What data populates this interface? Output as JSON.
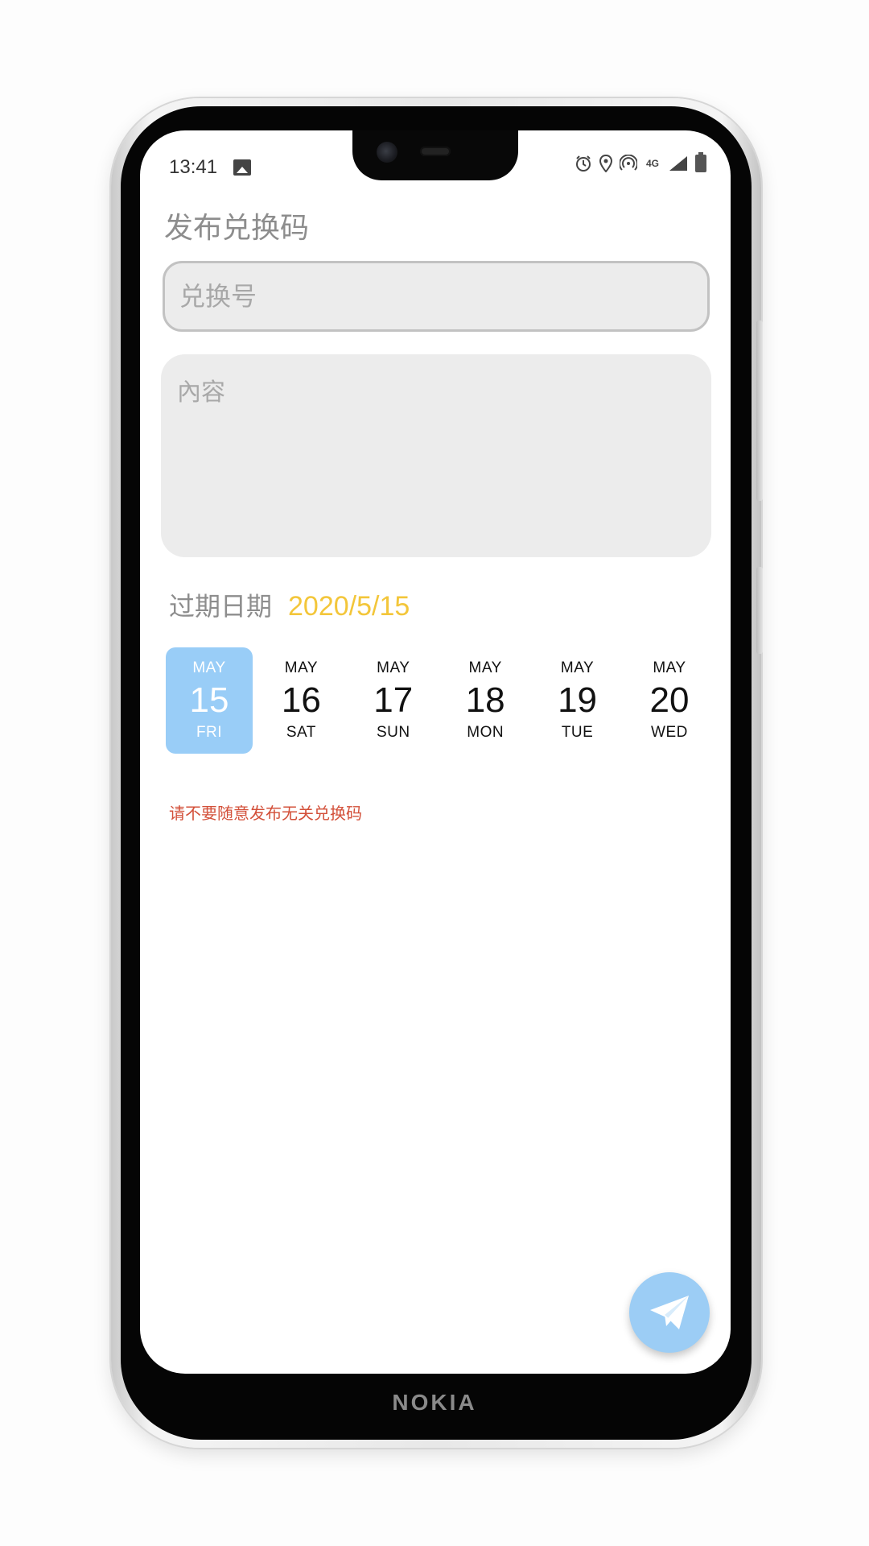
{
  "device": {
    "brand": "NOKIA"
  },
  "status_bar": {
    "time": "13:41",
    "network_label": "4G",
    "signal_label": "4G"
  },
  "page": {
    "title": "发布兑换码"
  },
  "form": {
    "code_placeholder": "兑换号",
    "code_value": "",
    "content_placeholder": "內容",
    "content_value": ""
  },
  "expiry": {
    "label": "过期日期",
    "value": "2020/5/15",
    "value_color": "#f3c63a"
  },
  "date_picker": {
    "selected_index": 0,
    "selected_color": "#99cdf7",
    "dates": [
      {
        "month": "MAY",
        "day": "15",
        "weekday": "FRI"
      },
      {
        "month": "MAY",
        "day": "16",
        "weekday": "SAT"
      },
      {
        "month": "MAY",
        "day": "17",
        "weekday": "SUN"
      },
      {
        "month": "MAY",
        "day": "18",
        "weekday": "MON"
      },
      {
        "month": "MAY",
        "day": "19",
        "weekday": "TUE"
      },
      {
        "month": "MAY",
        "day": "20",
        "weekday": "WED"
      }
    ]
  },
  "notice": {
    "text": "请不要随意发布无关兑换码",
    "color": "#d3503a"
  },
  "fab": {
    "icon": "send-icon",
    "color": "#9ccdf5"
  }
}
